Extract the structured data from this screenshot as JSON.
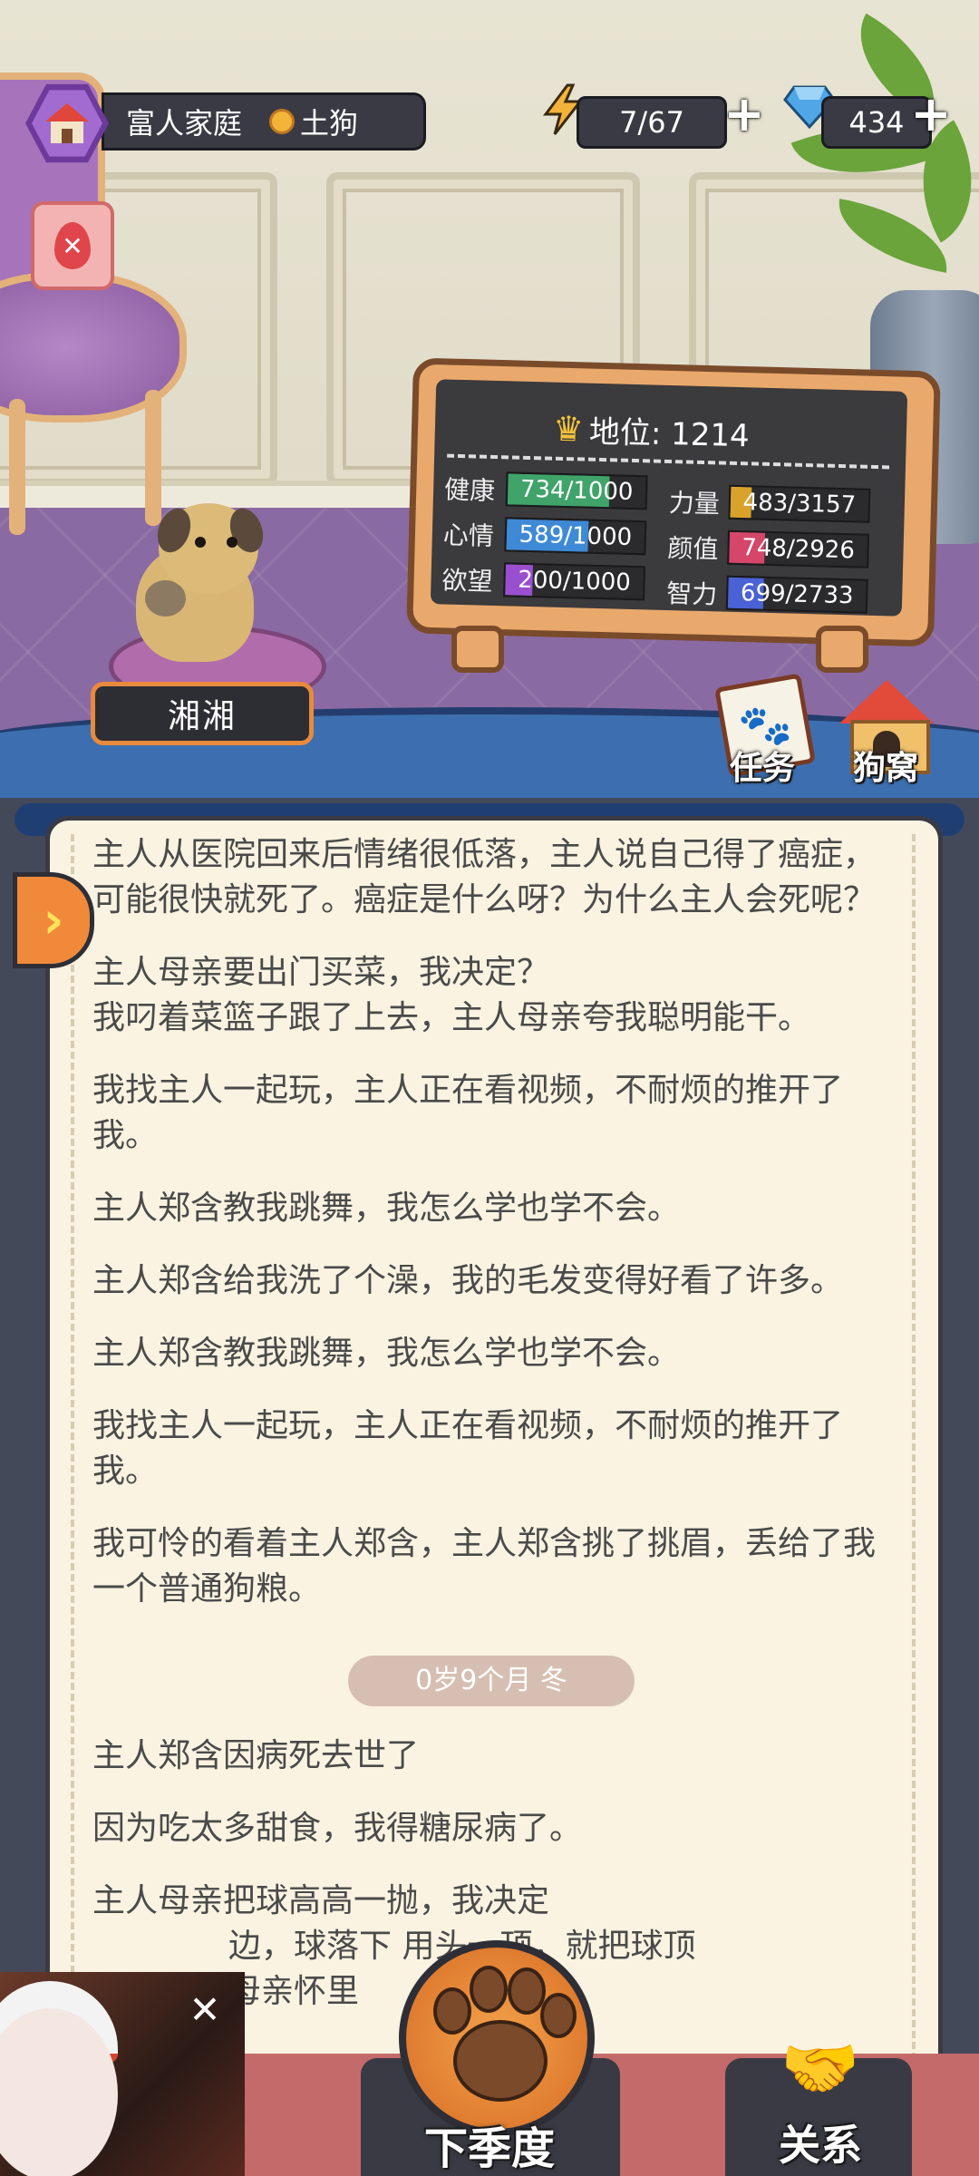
{
  "topbar": {
    "family": "富人家庭",
    "rank_title": "土狗",
    "energy": "7/67",
    "gems": "434"
  },
  "status_board": {
    "rank_label": "地位: 1214",
    "stats": {
      "health": {
        "label": "健康",
        "value": "734/1000",
        "fraction": 0.734,
        "color": "#3fa36a"
      },
      "strength": {
        "label": "力量",
        "value": "483/3157",
        "fraction": 0.153,
        "color": "#d9a22a"
      },
      "mood": {
        "label": "心情",
        "value": "589/1000",
        "fraction": 0.589,
        "color": "#3f8ad6"
      },
      "looks": {
        "label": "颜值",
        "value": "748/2926",
        "fraction": 0.256,
        "color": "#d6456a"
      },
      "desire": {
        "label": "欲望",
        "value": "200/1000",
        "fraction": 0.2,
        "color": "#9a4fd0"
      },
      "intellect": {
        "label": "智力",
        "value": "699/2733",
        "fraction": 0.256,
        "color": "#4a62d6"
      }
    }
  },
  "pet": {
    "name": "湘湘"
  },
  "corner": {
    "tasks": "任务",
    "kennel": "狗窝"
  },
  "log": {
    "entries": [
      "主人从医院回来后情绪很低落，主人说自己得了癌症，可能很快就死了。癌症是什么呀？为什么主人会死呢？",
      "主人母亲要出门买菜，我决定？",
      "我叼着菜篮子跟了上去，主人母亲夸我聪明能干。",
      "我找主人一起玩，主人正在看视频，不耐烦的推开了我。",
      "主人郑含教我跳舞，我怎么学也学不会。",
      "主人郑含给我洗了个澡，我的毛发变得好看了许多。",
      "主人郑含教我跳舞，我怎么学也学不会。",
      "我找主人一起玩，主人正在看视频，不耐烦的推开了我。",
      "我可怜的看着主人郑含，主人郑含挑了挑眉，丢给了我一个普通狗粮。"
    ],
    "season": "0岁9个月 冬",
    "entries2": [
      "主人郑含因病死去世了",
      "因为吃太多甜食，我得糖尿病了。",
      "主人母亲把球高高一抛，我决定",
      "边，球落下      用头一顶，就把球顶",
      "母亲怀里"
    ]
  },
  "bottom": {
    "next_season": "下季度",
    "relations": "关系"
  },
  "icons": [
    "house-icon",
    "medal-icon",
    "lightning-icon",
    "diamond-icon",
    "plus-icon",
    "blood-drop-icon",
    "crown-icon",
    "paw-book-icon",
    "kennel-icon",
    "chevron-right-icon",
    "paw-icon",
    "handshake-icon",
    "close-icon"
  ]
}
